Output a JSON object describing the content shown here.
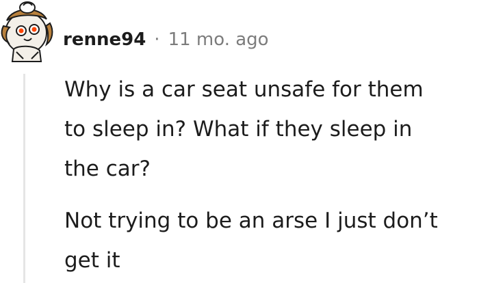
{
  "comment": {
    "username": "renne94",
    "separator": "·",
    "timestamp": "11 mo. ago",
    "avatar_icon": "snoo-avatar-icon",
    "paragraphs": [
      {
        "lines": [
          "Why is a car seat unsafe for them",
          "to sleep in? What if they sleep in",
          "the car?"
        ]
      },
      {
        "lines": [
          "Not trying to be an arse I just don’t",
          "get it"
        ]
      }
    ]
  },
  "colors": {
    "text": "#1c1c1c",
    "meta": "#7c7c7c",
    "thread_line": "#e5e5e5",
    "background": "#ffffff"
  }
}
